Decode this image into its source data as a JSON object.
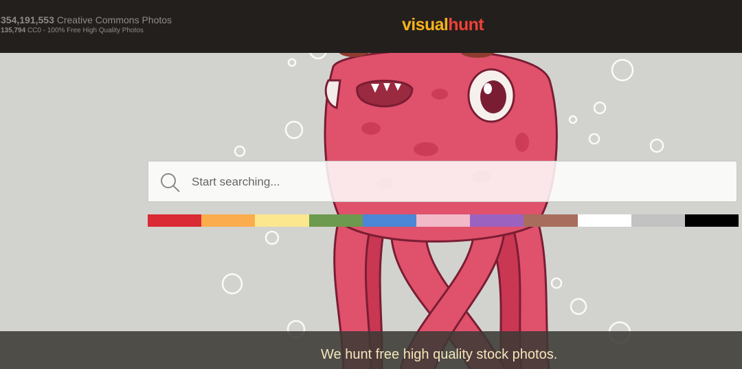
{
  "header": {
    "photo_count": "354,191,553",
    "photo_count_label": "Creative Commons Photos",
    "cc0_count": "135,794",
    "cc0_label": "CC0 - 100% Free High Quality Photos",
    "logo_part1": "visual",
    "logo_part2": "hunt"
  },
  "search": {
    "placeholder": "Start searching..."
  },
  "color_filters": [
    {
      "name": "red",
      "color": "#d92a35"
    },
    {
      "name": "orange",
      "color": "#fbac4c"
    },
    {
      "name": "yellow",
      "color": "#fde78e"
    },
    {
      "name": "green",
      "color": "#6c9a4e"
    },
    {
      "name": "blue",
      "color": "#4b87d6"
    },
    {
      "name": "pink",
      "color": "#f2b9c9"
    },
    {
      "name": "purple",
      "color": "#9c62c0"
    },
    {
      "name": "brown",
      "color": "#a86d5c"
    },
    {
      "name": "white",
      "color": "#ffffff"
    },
    {
      "name": "gray",
      "color": "#c2c2c2"
    },
    {
      "name": "black",
      "color": "#000000"
    }
  ],
  "footer": {
    "tagline": "We hunt free high quality stock photos."
  },
  "colors": {
    "topbar": "#231f1d",
    "background": "#d2d3ce",
    "logo_visual": "#f6b21b",
    "logo_hunt": "#ef4138",
    "creature": "#e0516c",
    "tagline": "#f3e7bd"
  }
}
